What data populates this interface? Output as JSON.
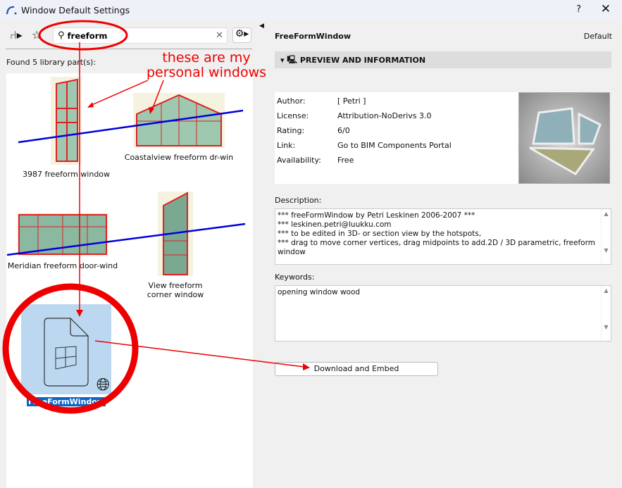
{
  "window": {
    "title": "Window Default Settings",
    "help": "?",
    "close": "✕"
  },
  "left": {
    "search": {
      "value": "freeform"
    },
    "found": "Found 5 library part(s):",
    "items": [
      {
        "label": "3987 freeform window"
      },
      {
        "label": "Coastalview freeform dr-win"
      },
      {
        "label": "Meridian freeform door-wind"
      },
      {
        "label": "View freeform corner window"
      },
      {
        "label": "FreeFormWindow"
      }
    ]
  },
  "right": {
    "title": "FreeFormWindow",
    "default": "Default",
    "section": "PREVIEW AND INFORMATION",
    "info": [
      {
        "k": "Author:",
        "v": "[ Petri ]"
      },
      {
        "k": "License:",
        "v": "Attribution-NoDerivs 3.0"
      },
      {
        "k": "Rating:",
        "v": "6/0"
      },
      {
        "k": "Link:",
        "v": "Go to BIM Components Portal"
      },
      {
        "k": "Availability:",
        "v": "Free"
      }
    ],
    "description_label": "Description:",
    "description": [
      "*** freeFormWindow by Petri Leskinen 2006-2007 ***",
      "*** leskinen.petri@luukku.com",
      "*** to be edited in 3D- or section view by the hotspots,",
      "*** drag to move corner vertices, drag midpoints to add.2D / 3D parametric, freeform window"
    ],
    "keywords_label": "Keywords:",
    "keywords": "opening window wood",
    "download": "Download and Embed"
  },
  "annotation": {
    "text": "these are my personal windows",
    "color": "#e00000"
  }
}
